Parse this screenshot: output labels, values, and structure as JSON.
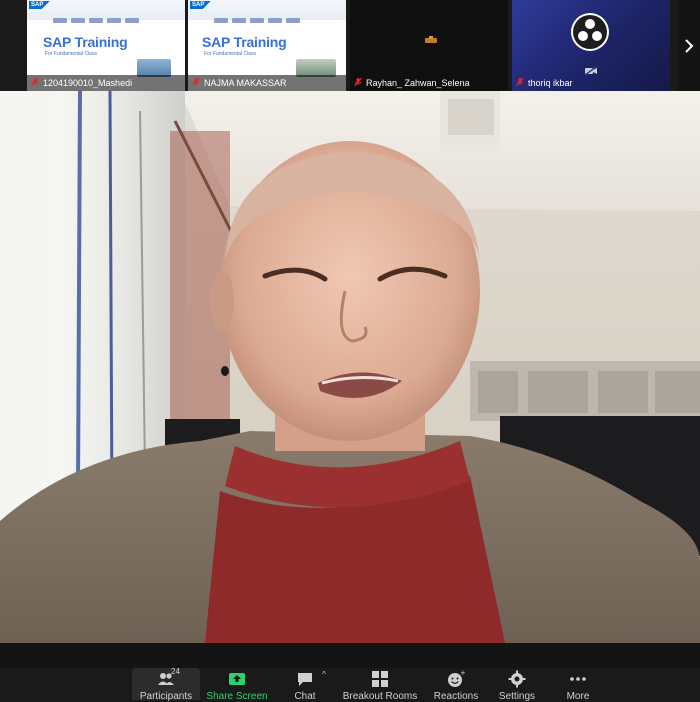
{
  "thumbnails": [
    {
      "slide_title": "SAP Training",
      "slide_subtitle": "For Fundamental Class",
      "slide_logo": "SAP",
      "name": "1204190010_Mashedi",
      "muted": true
    },
    {
      "slide_title": "SAP Training",
      "slide_subtitle": "For Fundamental Class",
      "slide_logo": "SAP",
      "name": "NAJMA MAKASSAR",
      "muted": true
    },
    {
      "name": "Rayhan_ Zahwan_Selena",
      "muted": true
    },
    {
      "name": "thoriq ikbar",
      "muted": true,
      "icon": "obs-studio-icon"
    }
  ],
  "toolbar": {
    "participants": {
      "label": "Participants",
      "count": "24"
    },
    "share": {
      "label": "Share Screen"
    },
    "chat": {
      "label": "Chat"
    },
    "breakout": {
      "label": "Breakout Rooms"
    },
    "reactions": {
      "label": "Reactions"
    },
    "settings": {
      "label": "Settings"
    },
    "more": {
      "label": "More"
    }
  },
  "colors": {
    "share_accent": "#2bd46a",
    "mute_red": "#e02828",
    "slide_title_blue": "#3a6fd6"
  }
}
